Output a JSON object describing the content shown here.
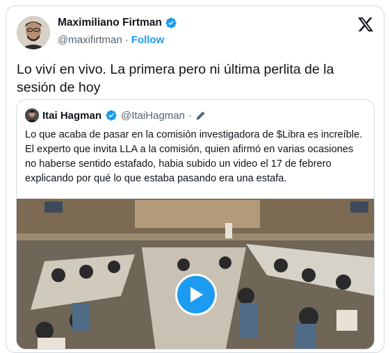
{
  "author": {
    "name": "Maximiliano Firtman",
    "handle": "@maxifirtman",
    "separator": "·",
    "follow_label": "Follow"
  },
  "tweet": {
    "text": "Lo viví en vivo. La primera pero ni última perlita de la sesión de hoy"
  },
  "quoted": {
    "name": "Itai Hagman",
    "handle": "@ItaiHagman",
    "separator": "·",
    "text": "Lo que acaba de pasar en la comisión investigadora de $Libra es increíble. El experto que invita LLA a la comisión, quien afirmó en varias ocasiones no haberse sentido estafado, habia subido un video el 17 de febrero explicando por qué lo que estaba pasando era una estafa."
  },
  "icons": {
    "verified": "verified-badge-icon",
    "x_logo": "x-logo-icon",
    "edit": "edit-pencil-icon",
    "play": "play-icon"
  },
  "colors": {
    "accent": "#1d9bf0",
    "text": "#0f1419",
    "secondary": "#536471",
    "border": "#cfd9de"
  }
}
